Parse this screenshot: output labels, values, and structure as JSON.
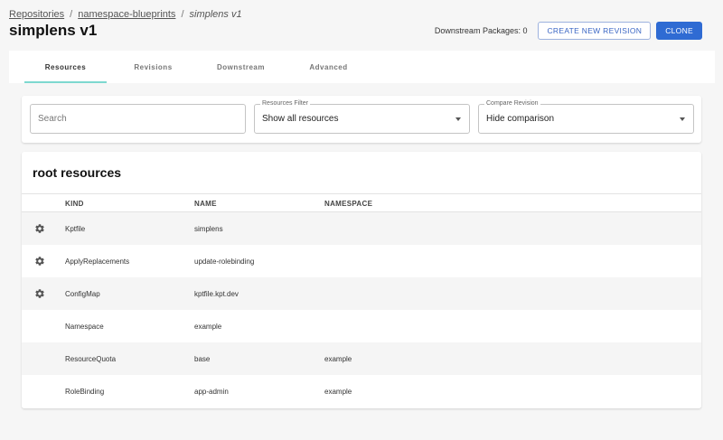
{
  "breadcrumb": {
    "items": [
      "Repositories",
      "namespace-blueprints"
    ],
    "separator": "/",
    "current": "simplens v1"
  },
  "page": {
    "title": "simplens v1"
  },
  "header": {
    "downstream_packages": "Downstream Packages: 0",
    "create_revision_label": "CREATE NEW REVISION",
    "clone_label": "CLONE"
  },
  "tabs": [
    "Resources",
    "Revisions",
    "Downstream",
    "Advanced"
  ],
  "filters": {
    "search_placeholder": "Search",
    "resources_filter": {
      "legend": "Resources Filter",
      "value": "Show all resources"
    },
    "compare_revision": {
      "legend": "Compare Revision",
      "value": "Hide comparison"
    }
  },
  "table": {
    "title": "root resources",
    "columns": {
      "kind": "KIND",
      "name": "NAME",
      "namespace": "NAMESPACE"
    },
    "rows": [
      {
        "kind": "Kptfile",
        "name": "simplens",
        "namespace": "",
        "icon": "gear-icon"
      },
      {
        "kind": "ApplyReplacements",
        "name": "update-rolebinding",
        "namespace": "",
        "icon": "gear-icon"
      },
      {
        "kind": "ConfigMap",
        "name": "kptfile.kpt.dev",
        "namespace": "",
        "icon": "gear-icon"
      },
      {
        "kind": "Namespace",
        "name": "example",
        "namespace": ""
      },
      {
        "kind": "ResourceQuota",
        "name": "base",
        "namespace": "example"
      },
      {
        "kind": "RoleBinding",
        "name": "app-admin",
        "namespace": "example"
      }
    ]
  },
  "colors": {
    "accent": "#7dd8d0",
    "primary": "#2f6bd3"
  }
}
